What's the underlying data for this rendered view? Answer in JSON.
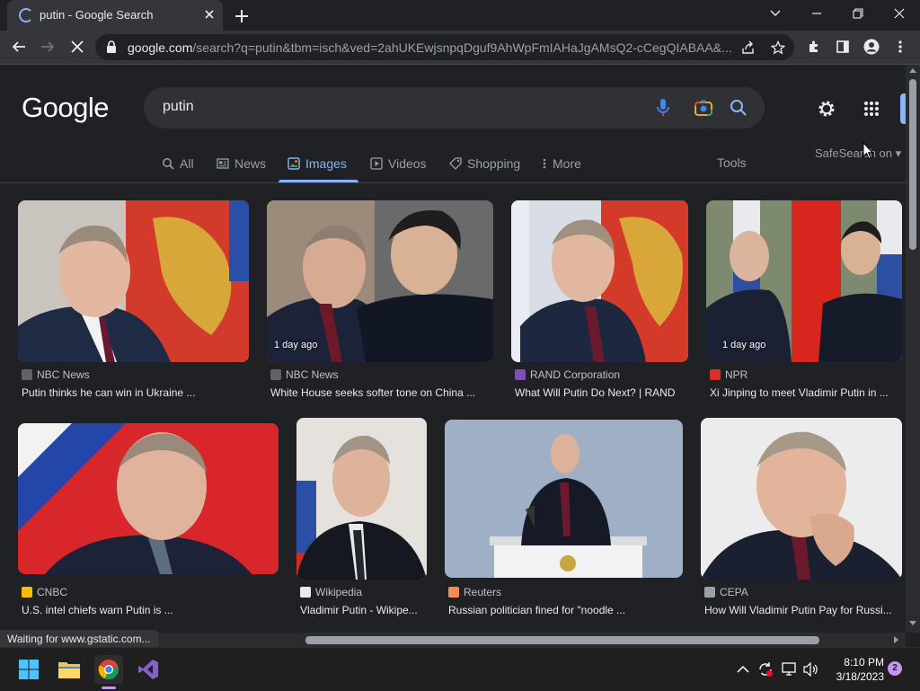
{
  "browser": {
    "tab_title": "putin - Google Search",
    "url_host": "google.com",
    "url_path": "/search?q=putin&tbm=isch&ved=2ahUKEwjsnpqDguf9AhWpFmIAHaJgAMsQ2-cCegQIABAA&..."
  },
  "search": {
    "logo": "Google",
    "query": "putin"
  },
  "result_tabs": [
    {
      "label": "All",
      "icon": "search-icon"
    },
    {
      "label": "News",
      "icon": "news-icon"
    },
    {
      "label": "Images",
      "icon": "image-icon",
      "active": true
    },
    {
      "label": "Videos",
      "icon": "play-icon"
    },
    {
      "label": "Shopping",
      "icon": "tag-icon"
    },
    {
      "label": "More",
      "icon": "more-vert-icon"
    }
  ],
  "tools_label": "Tools",
  "safesearch_label": "SafeSearch on",
  "results": [
    {
      "source": "NBC News",
      "caption": "Putin thinks he can win in Ukraine ...",
      "age": "",
      "fav_color": "#5f6368"
    },
    {
      "source": "NBC News",
      "caption": "White House seeks softer tone on China ...",
      "age": "1 day ago",
      "fav_color": "#5f6368"
    },
    {
      "source": "RAND Corporation",
      "caption": "What Will Putin Do Next? | RAND",
      "age": "",
      "fav_color": "#7b4fb3"
    },
    {
      "source": "NPR",
      "caption": "Xi Jinping to meet Vladimir Putin in ...",
      "age": "1 day ago",
      "fav_color": "#d93025"
    },
    {
      "source": "CNBC",
      "caption": "U.S. intel chiefs warn Putin is ...",
      "age": "",
      "fav_color": "#fbbc04"
    },
    {
      "source": "Wikipedia",
      "caption": "Vladimir Putin - Wikipe...",
      "age": "",
      "fav_color": "#e8eaed"
    },
    {
      "source": "Reuters",
      "caption": "Russian politician fined for \"noodle ...",
      "age": "",
      "fav_color": "#f28b54"
    },
    {
      "source": "CEPA",
      "caption": "How Will Vladimir Putin Pay for Russi...",
      "age": "",
      "fav_color": "#9aa0a6"
    }
  ],
  "status_text": "Waiting for www.gstatic.com...",
  "taskbar": {
    "time": "8:10 PM",
    "date": "3/18/2023",
    "notification_count": "2"
  },
  "colors": {
    "background": "#202124",
    "accent": "#8ab4f8",
    "text": "#e8eaed",
    "muted_text": "#9aa0a6"
  }
}
